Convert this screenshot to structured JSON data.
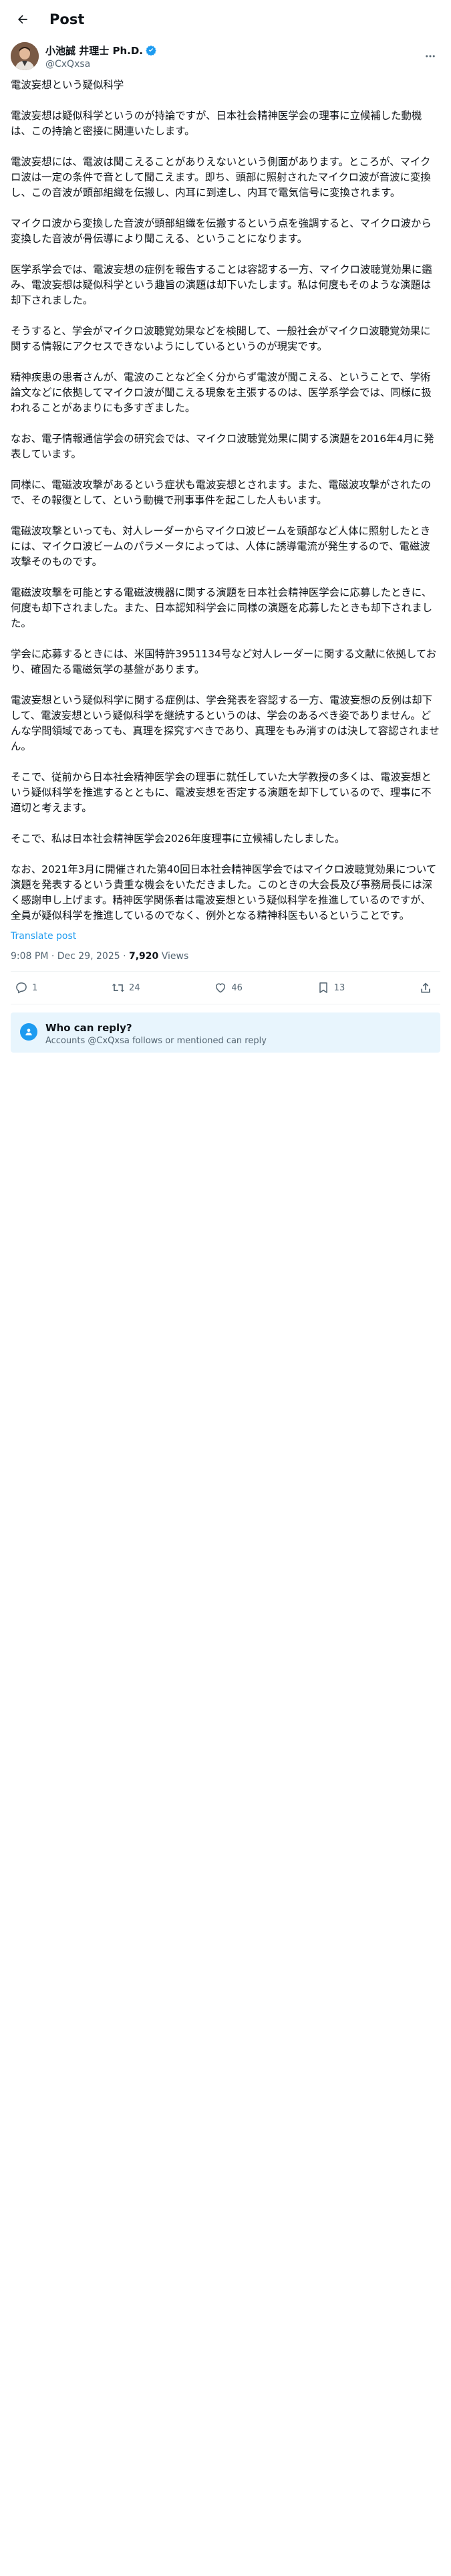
{
  "header": {
    "title": "Post"
  },
  "author": {
    "display_name": "小池誠 井理士 Ph.D.",
    "handle": "@CxQxsa",
    "avatar_icon": "person-avatar",
    "verified_icon": "verified-badge-icon"
  },
  "post": {
    "paragraphs": [
      "電波妄想という疑似科学",
      "電波妄想は疑似科学というのが持論ですが、日本社会精神医学会の理事に立候補した動機は、この持論と密接に関連いたします。",
      "電波妄想には、電波は聞こえることがありえないという側面があります。ところが、マイクロ波は一定の条件で音として聞こえます。即ち、頭部に照射されたマイクロ波が音波に変換し、この音波が頭部組織を伝搬し、内耳に到達し、内耳で電気信号に変換されます。",
      "マイクロ波から変換した音波が頭部組織を伝搬するという点を強調すると、マイクロ波から変換した音波が骨伝導により聞こえる、ということになります。",
      "医学系学会では、電波妄想の症例を報告することは容認する一方、マイクロ波聴覚効果に鑑み、電波妄想は疑似科学という趣旨の演題は却下いたします。私は何度もそのような演題は却下されました。",
      "そうすると、学会がマイクロ波聴覚効果などを検閲して、一般社会がマイクロ波聴覚効果に関する情報にアクセスできないようにしているというのが現実です。",
      "精神疾患の患者さんが、電波のことなど全く分からず電波が聞こえる、ということで、学術論文などに依拠してマイクロ波が聞こえる現象を主張するのは、医学系学会では、同様に扱われることがあまりにも多すぎました。",
      "なお、電子情報通信学会の研究会では、マイクロ波聴覚効果に関する演題を2016年4月に発表しています。",
      "同様に、電磁波攻撃があるという症状も電波妄想とされます。また、電磁波攻撃がされたので、その報復として、という動機で刑事事件を起こした人もいます。",
      "電磁波攻撃といっても、対人レーダーからマイクロ波ビームを頭部など人体に照射したときには、マイクロ波ビームのパラメータによっては、人体に誘導電流が発生するので、電磁波攻撃そのものです。",
      "電磁波攻撃を可能とする電磁波機器に関する演題を日本社会精神医学会に応募したときに、何度も却下されました。また、日本認知科学会に同様の演題を応募したときも却下されました。",
      "学会に応募するときには、米国特許3951134号など対人レーダーに関する文献に依拠しており、確固たる電磁気学の基盤があります。",
      "電波妄想という疑似科学に関する症例は、学会発表を容認する一方、電波妄想の反例は却下して、電波妄想という疑似科学を継続するというのは、学会のあるべき姿でありません。どんな学問領域であっても、真理を探究すべきであり、真理をもみ消すのは決して容認されません。",
      "そこで、従前から日本社会精神医学会の理事に就任していた大学教授の多くは、電波妄想という疑似科学を推進するとともに、電波妄想を否定する演題を却下しているので、理事に不適切と考えます。",
      "そこで、私は日本社会精神医学会2026年度理事に立候補したしました。",
      "なお、2021年3月に開催された第40回日本社会精神医学会ではマイクロ波聴覚効果について演題を発表するという貴重な機会をいただきました。このときの大会長及び事務局長には深く感謝申し上げます。精神医学関係者は電波妄想という疑似科学を推進しているのですが、全員が疑似科学を推進しているのでなく、例外となる精神科医もいるということです。"
    ],
    "translate_label": "Translate post",
    "time": "9:08 PM · Dec 29, 2025 · ",
    "views_count": "7,920",
    "views_label": " Views"
  },
  "actions": {
    "reply_count": "1",
    "repost_count": "24",
    "like_count": "46",
    "bookmark_count": "13"
  },
  "reply_restriction": {
    "title": "Who can reply?",
    "subtitle": "Accounts @CxQxsa follows or mentioned can reply"
  },
  "colors": {
    "accent": "#1d9bf0",
    "muted_text": "#536471",
    "reply_box_bg": "#e8f5fd"
  }
}
